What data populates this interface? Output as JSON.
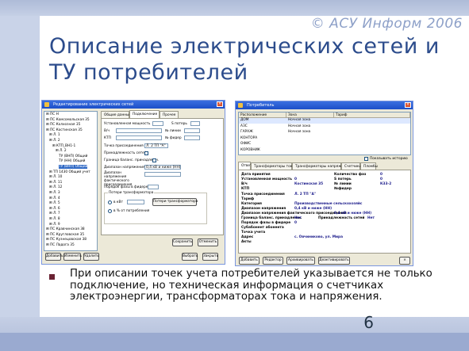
{
  "slide": {
    "brand": "© АСУ Информ 2006",
    "title": "Описание электрических сетей и ТУ потребителей",
    "bullet": "При описании точек учета потребителей указывается не только подключение, но техническая информация о счетчиках электроэнергии, трансформаторах тока и напряжения.",
    "page_number": "6"
  },
  "left_window": {
    "title": "Редактирование электрических сетей",
    "tree": [
      {
        "label": "ПС Н",
        "indent": 0
      },
      {
        "label": "ПС Комсомольская 35",
        "indent": 0
      },
      {
        "label": "ПС Колхозная 35",
        "indent": 0
      },
      {
        "label": "ПС Костинская 35",
        "indent": 0
      },
      {
        "label": "Л. 1",
        "indent": 1
      },
      {
        "label": "Л. 2",
        "indent": 1
      },
      {
        "label": "КТП_ВН1-1",
        "indent": 2
      },
      {
        "label": "Л. 2",
        "indent": 3
      },
      {
        "label": "ТУ (ВНП) Общий",
        "indent": 4
      },
      {
        "label": "ТУ (НН) Общий",
        "indent": 4
      },
      {
        "label": "ТУ (ВНП) Общий",
        "indent": 4,
        "selected": true
      },
      {
        "label": "ТП 1430 Общий учет",
        "indent": 1
      },
      {
        "label": "Л. 10",
        "indent": 1
      },
      {
        "label": "Л. 11",
        "indent": 1
      },
      {
        "label": "Л. 12",
        "indent": 1
      },
      {
        "label": "Л. 3",
        "indent": 1
      },
      {
        "label": "Л. 4",
        "indent": 1
      },
      {
        "label": "Л. 5",
        "indent": 1
      },
      {
        "label": "Л. 6",
        "indent": 1
      },
      {
        "label": "Л. 7",
        "indent": 1
      },
      {
        "label": "Л. 8",
        "indent": 1
      },
      {
        "label": "Л. 9",
        "indent": 1
      },
      {
        "label": "ПС Кравчинская 38",
        "indent": 0
      },
      {
        "label": "ПС Кругловская 35",
        "indent": 0
      },
      {
        "label": "ПС Кузнецовская 38",
        "indent": 0
      },
      {
        "label": "ПС Ладога 35",
        "indent": 0
      }
    ],
    "tabs": [
      "Общие данные",
      "Подключение",
      "Прочее"
    ],
    "form": {
      "installed_power": "Установленная мощность",
      "s_loss": "S потерь",
      "pu": "В/ч",
      "w_line": "№ линии",
      "ktp": "КТП",
      "feeder": "№ фидер",
      "connection_point": "Точка присоединения",
      "connection_point_value": "Л. 2 ТП \"А\"",
      "network_affiliation": "Принадлежность сетей",
      "balance_border": "Граница баланс. принадлежн.",
      "voltage_range": "Диапазон напряжения",
      "voltage_range_value": "0,4 кВ и ниже (НН)",
      "factual_voltage": "Диапазон напряжения фактического присоединения",
      "order_in_feeder": "Порядок фазы в фидере",
      "loss_account": "Потери трансформатора",
      "opt_kvt": "в кВт",
      "opt_consumer": "в % от потребления",
      "btn_transformer_losses": "Потери трансформатора"
    },
    "buttons": {
      "add": "Добавить",
      "edit": "Изменить",
      "delete": "Удалить",
      "save": "Сохранить",
      "cancel": "Отменить",
      "choose": "Выбрать",
      "close": "Закрыть"
    }
  },
  "right_window": {
    "title": "Потребитель",
    "grid": {
      "columns": [
        "Расположение",
        "Зона",
        "Тариф"
      ],
      "rows": [
        {
          "location": "ДОМ",
          "zone": "Ночная зона"
        },
        {
          "location": "АЗС",
          "zone": "Ночная зона"
        },
        {
          "location": "ГАРАЖ",
          "zone": "Ночная зона"
        },
        {
          "location": "КОНТОРА",
          "zone": ""
        },
        {
          "location": "ОФИС",
          "zone": ""
        },
        {
          "location": "КОРОВНИК",
          "zone": ""
        }
      ],
      "show_history": "Показывать историю"
    },
    "tabs": [
      "Ответ",
      "Трансформаторы тока",
      "Трансформаторы напряжения",
      "Счетчики",
      "Пломбы"
    ],
    "fields": {
      "accept_date": "Дата принятия",
      "phases_count": "Количество фаз",
      "phases_count_value": "0",
      "installed_power": "Установленная мощность",
      "installed_power_value": "0",
      "s_loss": "S потерь",
      "s_loss_value": "0",
      "pu": "В/ч",
      "pu_value": "Костинская 35",
      "w_line": "№ линии",
      "w_line_value": "К33-2",
      "ktp": "КТП",
      "feeder": "№фидер",
      "connection_point": "Точка присоединения",
      "connection_point_value": "Л. 2 ТП \"А\"",
      "tariff": "Тариф",
      "category": "Категория",
      "category_value": "Производственные сельскохозяйс",
      "voltage_range": "Диапазон напряжения",
      "voltage_range_value": "0,4 кВ и ниже (НН)",
      "factual_voltage": "Диапазон напряжения фактического присоединения",
      "factual_voltage_value": "0,4 кВ и ниже (НН)",
      "balance_border": "Граница баланс. принадлежн.",
      "balance_border_value": "Нет",
      "network_affiliation": "Принадлежность сетей",
      "network_affiliation_value": "Нет",
      "phase_order": "Порядок фазы в фидере",
      "phase_order_value": "0",
      "subscriber_org": "Субабонент абонента",
      "subscriber_org_value": "",
      "loss_point": "Точка учета",
      "loss_point_value": "",
      "address": "Адрес",
      "address_value": "с. Овчиниково, ул. Мира",
      "act": "Акты"
    },
    "buttons": {
      "add": "Добавить",
      "edit": "Редактор",
      "archive": "Архивировать",
      "deactivate": "Деактивировать"
    }
  }
}
